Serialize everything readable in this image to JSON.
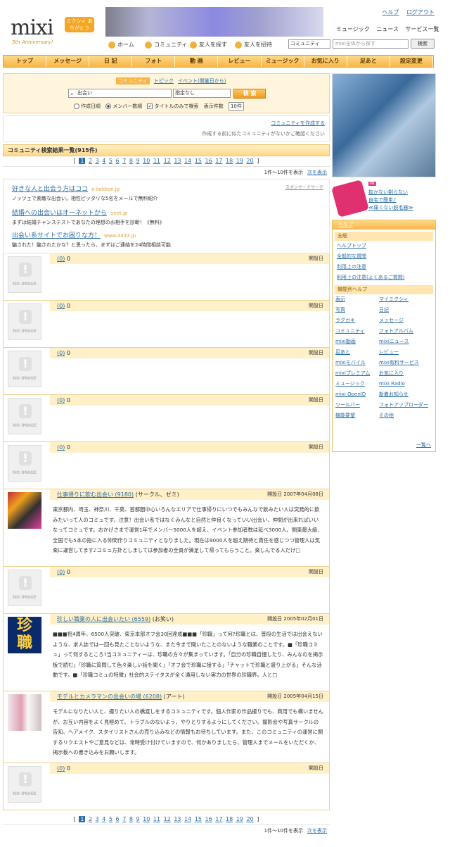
{
  "header": {
    "logo": "mixi",
    "badge": "ミクシィ ありがとう",
    "anniversary": "5th Anniversary!",
    "top_links": [
      "ヘルプ",
      "ログアウト"
    ],
    "sub_links": [
      "ミュージック",
      "ニュース",
      "サービス一覧"
    ],
    "nav2": [
      "ホーム",
      "コミュニティ",
      "友人を探す",
      "友人を招待"
    ],
    "search_scope": "コミュニティ",
    "search_placeholder": "mixi全体から探す",
    "search_button": "検索"
  },
  "main_nav": [
    "トップ",
    "メッセージ",
    "日 記",
    "フォト",
    "動 画",
    "レビュー",
    "ミュージック",
    "お気に入り",
    "足あと",
    "設定変更"
  ],
  "search": {
    "tabs": [
      "コミュニティ",
      "トピック",
      "イベント(開催日から)"
    ],
    "keyword": "出会い",
    "category": "指定なし",
    "button": "検 索",
    "opt_date": "作成日順",
    "opt_members": "メンバー数順",
    "opt_title": "タイトルのみで検索",
    "opt_count_label": "表示件数",
    "opt_count": "10件"
  },
  "create": {
    "link": "コミュニティを作成する",
    "note": "作成する前に似たコミュニティがないかご確認ください"
  },
  "results": {
    "heading": "コミュニティ検索結果一覧(915件)",
    "pages": [
      "1",
      "2",
      "3",
      "4",
      "5",
      "6",
      "7",
      "8",
      "9",
      "10",
      "11",
      "12",
      "13",
      "14",
      "15",
      "16",
      "17",
      "18",
      "19",
      "20"
    ],
    "range": "1件～10件を表示",
    "next": "次を表示"
  },
  "ads": {
    "sponsored": "スポンサードサーチ",
    "items": [
      {
        "title": "好きな人と出会う方はココ",
        "url": "e-kekkon.jp",
        "desc": "ノッツェで素敵な出会い。相性ピッタリな5名をメールで無料紹介"
      },
      {
        "title": "結婚への出会いはオーネットから",
        "url": "onet.jp",
        "desc": "まずは結婚チャンステストであなたの理想のお相手を診断！《無料》"
      },
      {
        "title": "出会い系サイトでお困りな方！",
        "url": "www.4433.jp",
        "desc": "騙された！騙されたかな？と思ったら、まずはご連絡を24時間相談可能"
      }
    ]
  },
  "noimage_label": "NO IMAGE",
  "items": [
    {
      "name": "(0)",
      "extra": "0",
      "date": "開設日",
      "desc": ""
    },
    {
      "name": "(0)",
      "extra": "0",
      "date": "開設日",
      "desc": ""
    },
    {
      "name": "(0)",
      "extra": "0",
      "date": "開設日",
      "desc": ""
    },
    {
      "name": "(0)",
      "extra": "0",
      "date": "開設日",
      "desc": ""
    },
    {
      "name": "(0)",
      "extra": "0",
      "date": "開設日",
      "desc": ""
    },
    {
      "name": "仕事帰りに飲む出会い (9180)",
      "extra": "(サークル、ゼミ)",
      "date": "開設日 2007年04月08日",
      "desc": "東京都内、埼玉、神奈川、千葉、首都圏中心いろんなエリアで仕事帰りにいつでもみんなで飲みたい人は突発的に飲みたいって人のコミュです。注意！出会い系ではなくみんなと自然と仲良くなっていい出会い、仲間が出来ればいいなってコミュです。おかげさまで運営1年でメンバー5000人を超え、イベント参加者数は延べ3000人。関東最大級、全国でも5本の指に入る仲間作りコミュニティとなりました。現在は9000人を超え期待と責任を感じつつ管理人は気楽に運営してます♪コミュ方針としましては参加者の全員が満足して帰ってもらうこと。楽しんでる人だけ□"
    },
    {
      "name": "(0)",
      "extra": "0",
      "date": "開設日",
      "desc": ""
    },
    {
      "name": "珍しい職業の人に出会いたい (6559)",
      "extra": "(お笑い)",
      "date": "開設日 2005年02月01日",
      "desc": "■■■祝4周年、6500人突破、東京本部オフ会30回達成■■■「珍職」って何?珍職とは、普段の生活では出会えないような、求人誌では一回も見たことないような、また今まで聞いたことのないような職業のことです。■「珍職コミュ」って何するところ?当コミュニティーは、珍職の方々が集まっています。「自分の珍職自慢したり、みんなのを掲示板で読む」「珍職に質問して色々楽しい話を聞く」「オフ会で珍職に接する」「チャットで珍職と盛り上がる」そんな活動です。■「珍職コミュの特徴」社会的ステイタスが全く通用しない実力の世界の珍職界。人と□"
    },
    {
      "name": "モデルとカメラマンの出会いの場 (6208)",
      "extra": "(アート)",
      "date": "開設日 2005年04月15日",
      "desc": "モデルになりたい人と、撮りたい人の橋渡しをするコミュニティです。個人作家の作品撮りでも、商用でも構いませんが、お互い内容をよく見極めて、トラブルのないよう、やりとりするようにしてください。撮影会や写真サークルの告知、ヘアメイク、スタイリストさんの売り込みなどの情報もお待ちしています。また、このコミュニティの運営に関するリクエストやご意見などは、常時受け付けていますので、何かありましたら、管理人までメールをいただくか、掲示板への書き込みをお願いします。"
    },
    {
      "name": "(0)",
      "extra": "0",
      "date": "開設日",
      "desc": ""
    }
  ],
  "right": {
    "ad_pr": "PR",
    "ad_lines": [
      "抜かない剃らない",
      "自宅で簡単♪",
      "≪痛くない脱毛器≫"
    ],
    "help_title": "ヘルプ",
    "sec1": "全般",
    "general": [
      "ヘルプトップ",
      "全般的な質問",
      "利用上の注意",
      "利用上の注意(よくあるご質問)"
    ],
    "sec2": "機能別ヘルプ",
    "features": [
      "表示",
      "マイミクシィ",
      "写真",
      "日記",
      "ラグガキ",
      "メッセージ",
      "コミュニティ",
      "フォトアルバム",
      "mixi動画",
      "mixiニュース",
      "足あと",
      "レビュー",
      "mixiモバイル",
      "mixi有料サービス",
      "mixiプレミアム",
      "お気に入り",
      "ミュージック",
      "mixi Radio",
      "mixi OpenID",
      "新着お知らせ",
      "ツールバー",
      "フォトアップローダー",
      "機能要望",
      "その他"
    ],
    "more": "一覧へ"
  }
}
